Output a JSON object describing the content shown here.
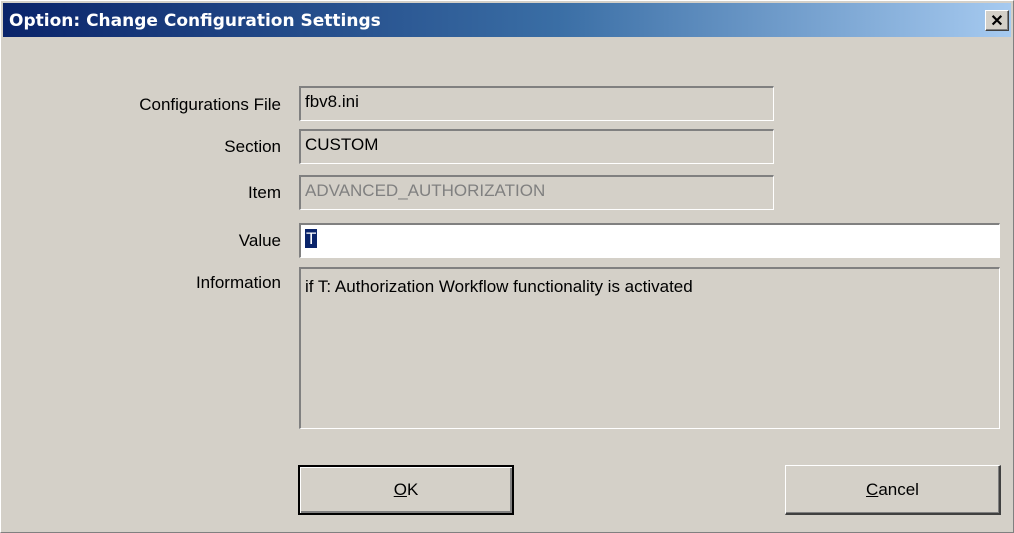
{
  "window": {
    "title": "Option: Change Configuration Settings",
    "close_glyph": "✕"
  },
  "form": {
    "config_file": {
      "label": "Configurations File",
      "value": "fbv8.ini"
    },
    "section": {
      "label": "Section",
      "value": "CUSTOM"
    },
    "item": {
      "label": "Item",
      "value": "ADVANCED_AUTHORIZATION"
    },
    "value": {
      "label": "Value",
      "value": "T"
    },
    "information": {
      "label": "Information",
      "value": "if T: Authorization Workflow functionality is activated"
    }
  },
  "buttons": {
    "ok": {
      "mnemonic": "O",
      "rest": "K"
    },
    "cancel": {
      "mnemonic": "C",
      "rest": "ancel"
    }
  }
}
